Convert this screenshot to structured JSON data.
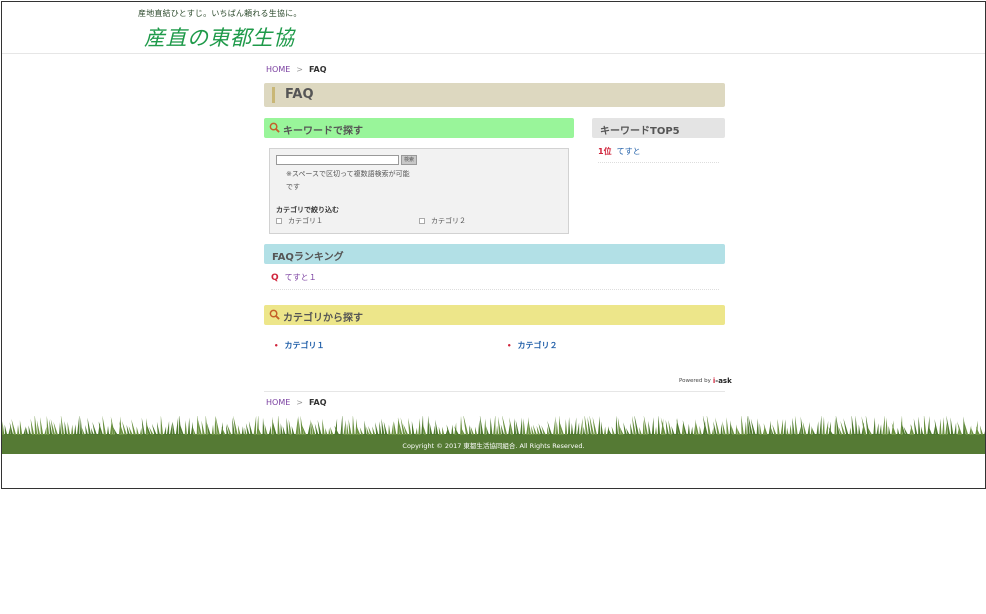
{
  "header": {
    "tagline": "産地直結ひとすじ。いちばん頼れる生協に。",
    "logo_text": "産直の東都生協"
  },
  "breadcrumb": {
    "home": "HOME",
    "separator": ">",
    "current": "FAQ"
  },
  "page_title": "FAQ",
  "keyword_search": {
    "heading": "キーワードで探す",
    "input_value": "",
    "button_label": "検索",
    "note": "※スペースで区切って複数語検索が可能です",
    "filter_heading": "カテゴリで絞り込む",
    "categories": [
      "カテゴリ１",
      "カテゴリ２"
    ]
  },
  "keyword_top5": {
    "heading": "キーワードTOP5",
    "items": [
      {
        "rank": "1位",
        "keyword": "てすと"
      }
    ]
  },
  "faq_ranking": {
    "heading": "FAQランキング",
    "items": [
      {
        "marker": "Q",
        "question": "てすと１"
      }
    ]
  },
  "category_search": {
    "heading": "カテゴリから探す",
    "links": [
      "カテゴリ１",
      "カテゴリ２"
    ]
  },
  "powered_by": {
    "prefix": "Powered by",
    "brand_i": "i",
    "brand_rest": "-ask"
  },
  "footer": {
    "copyright": "Copyright © 2017 東都生活協同組合. All Rights Reserved."
  },
  "colors": {
    "logo_green": "#1f9a4a",
    "keyword_head": "#99f59a",
    "ranking_head": "#b2e0e6",
    "category_head": "#ede68a",
    "title_bar": "#ddd8c0",
    "accent_red": "#d0243b",
    "grass": "#557a34"
  }
}
